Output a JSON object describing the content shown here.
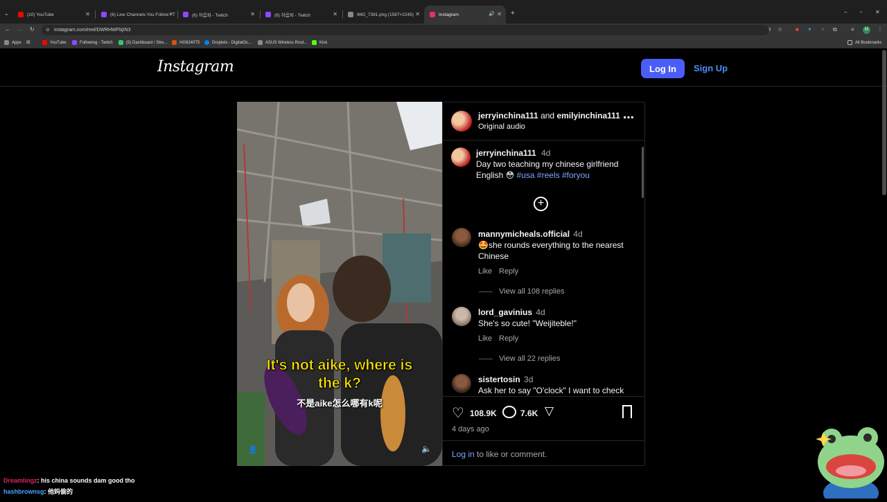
{
  "browser": {
    "tabs": [
      {
        "title": "(10) YouTube",
        "favicon_color": "#ff0000"
      },
      {
        "title": "(6) Live Channels You Follow - T",
        "favicon_color": "#9146ff"
      },
      {
        "title": "(6) 하음파 - Twitch",
        "favicon_color": "#9146ff"
      },
      {
        "title": "(6) 하음파 - Twitch",
        "favicon_color": "#9146ff"
      },
      {
        "title": "IMG_7391.png (1587×2245)",
        "favicon_color": "#888888"
      },
      {
        "title": "Instagram",
        "favicon_color": "#e1306c"
      }
    ],
    "url": "instagram.com/reel/DWRHWFbjIN3",
    "bookmarks": [
      {
        "label": "Apps",
        "color": "#888888"
      },
      {
        "label": "YouTube",
        "color": "#ff0000"
      },
      {
        "label": "Following - Twitch",
        "color": "#9146ff"
      },
      {
        "label": "(5) Dashboard / Stre...",
        "color": "#2ecc71"
      },
      {
        "label": "HG8240T5",
        "color": "#d35400"
      },
      {
        "label": "Droplets - DigitalOc...",
        "color": "#0080ff"
      },
      {
        "label": "ASUS Wireless Rout...",
        "color": "#7f8c8d"
      },
      {
        "label": "Kick",
        "color": "#53fc18"
      }
    ],
    "all_bookmarks": "All Bookmarks"
  },
  "instagram": {
    "logo": "Instagram",
    "login_label": "Log In",
    "signup_label": "Sign Up",
    "post": {
      "author1": "jerryinchina111",
      "and": "and",
      "author2": "emilyinchina111",
      "audio": "Original audio",
      "caption_user": "jerryinchina111",
      "caption_time": "4d",
      "caption_line1": "Day two teaching my chinese girlfriend",
      "caption_line2_text": "English 😳",
      "hashtags": [
        "#usa",
        "#reels",
        "#foryou"
      ],
      "subtitle_line1": "It's not aike, where is",
      "subtitle_line2": "the k?",
      "subtitle_cn": "不是aike怎么哪有k呢",
      "likes": "108.9K",
      "comments_count": "7.6K",
      "posted": "4 days ago",
      "login_prompt_link": "Log in",
      "login_prompt_rest": " to like or comment."
    },
    "comments": [
      {
        "user": "mannymicheals.official",
        "time": "4d",
        "line1": "🤩she rounds everything to the nearest",
        "line2": "Chinese",
        "like": "Like",
        "reply": "Reply",
        "replies": "View all 108 replies"
      },
      {
        "user": "lord_gavinius",
        "time": "4d",
        "line1": "She's so cute! \"Weijiteble!\"",
        "like": "Like",
        "reply": "Reply",
        "replies": "View all 22 replies"
      },
      {
        "user": "sistertosin",
        "time": "3d",
        "line1": "Ask her to say \"O'clock\" I want to check"
      }
    ]
  },
  "chat": [
    {
      "user": "Dreamlingz",
      "user_color": "#e0245e",
      "msg": "his china sounds dam good tho"
    },
    {
      "user": "hashbrownsg",
      "user_color": "#4aa3ff",
      "msg": "他妈偷的"
    }
  ]
}
